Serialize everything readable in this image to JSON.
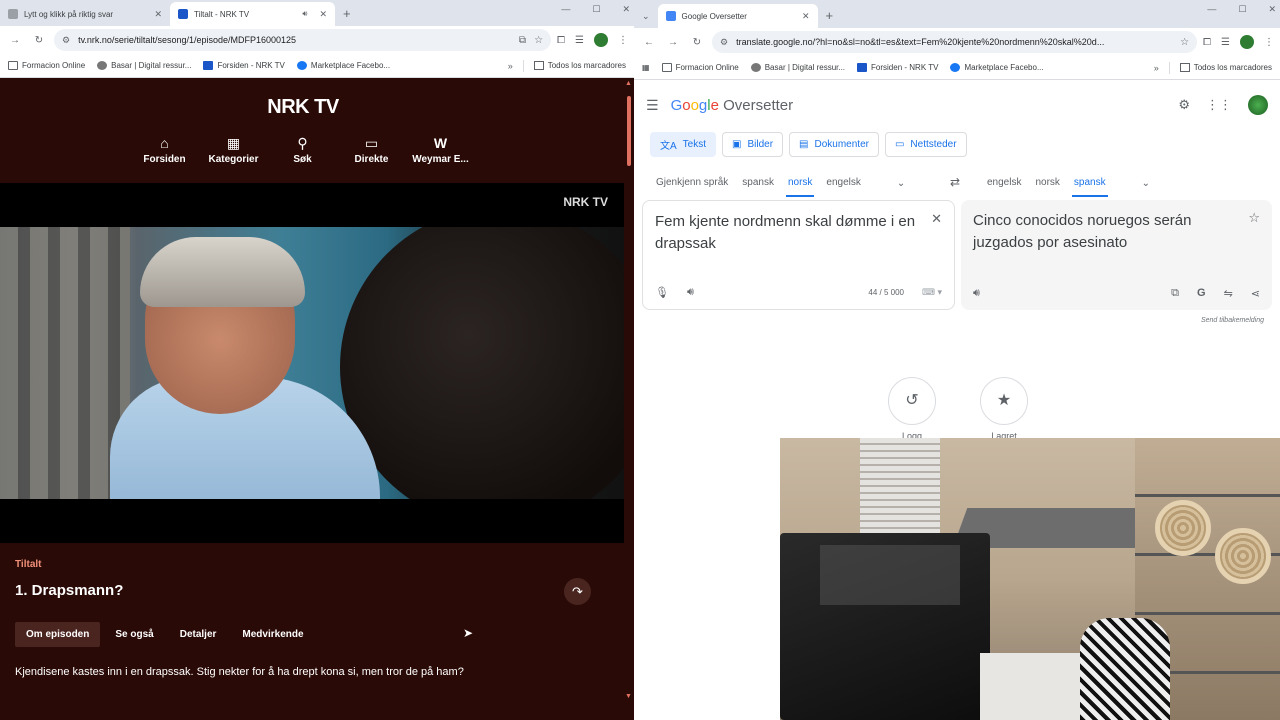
{
  "left_browser": {
    "tabs": [
      {
        "label": "Lytt og klikk på riktig svar",
        "active": false,
        "favicon_color": "#9aa0a6"
      },
      {
        "label": "Tiltalt - NRK TV",
        "active": true,
        "favicon_color": "#1a56c8"
      }
    ],
    "url": "tv.nrk.no/serie/tiltalt/sesong/1/episode/MDFP16000125",
    "bookmarks": [
      {
        "label": "Formacion Online",
        "icon": "folder-icon"
      },
      {
        "label": "Basar | Digital ressur...",
        "icon": "basar-icon"
      },
      {
        "label": "Forsiden - NRK TV",
        "icon": "nrk-icon"
      },
      {
        "label": "Marketplace Facebo...",
        "icon": "facebook-icon"
      }
    ],
    "bookmarks_more": "»",
    "all_bookmarks": "Todos los marcadores"
  },
  "nrk": {
    "logo": "NRK TV",
    "nav": [
      {
        "label": "Forsiden",
        "icon": "home-icon",
        "glyph": "⌂"
      },
      {
        "label": "Kategorier",
        "icon": "grid-icon",
        "glyph": "▦"
      },
      {
        "label": "Søk",
        "icon": "search-icon",
        "glyph": "⚲"
      },
      {
        "label": "Direkte",
        "icon": "tv-icon",
        "glyph": "▭"
      },
      {
        "label": "Weymar E...",
        "icon": "profile-initial-icon",
        "glyph": "W"
      }
    ],
    "player_watermark": "NRK TV",
    "series": "Tiltalt",
    "episode_title": "1. Drapsmann?",
    "tabs": [
      "Om episoden",
      "Se også",
      "Detaljer",
      "Medvirkende"
    ],
    "active_tab": 0,
    "description": "Kjendisene kastes inn i en drapssak. Stig nekter for å ha drept kona si, men tror de på ham?"
  },
  "right_browser": {
    "tabs": [
      {
        "label": "Google Oversetter",
        "active": true,
        "favicon_color": "#4285f4"
      }
    ],
    "url": "translate.google.no/?hl=no&sl=no&tl=es&text=Fem%20kjente%20nordmenn%20skal%20d...",
    "bookmarks": [
      {
        "label": "Formacion Online",
        "icon": "folder-icon"
      },
      {
        "label": "Basar | Digital ressur...",
        "icon": "basar-icon"
      },
      {
        "label": "Forsiden - NRK TV",
        "icon": "nrk-icon"
      },
      {
        "label": "Marketplace Facebo...",
        "icon": "facebook-icon"
      }
    ],
    "bookmarks_more": "»",
    "all_bookmarks": "Todos los marcadores"
  },
  "translate": {
    "app_title": "Google Oversetter",
    "modes": [
      {
        "label": "Tekst",
        "icon": "translate-icon",
        "glyph": "文A",
        "active": true
      },
      {
        "label": "Bilder",
        "icon": "image-icon",
        "glyph": "▣",
        "active": false
      },
      {
        "label": "Dokumenter",
        "icon": "document-icon",
        "glyph": "▤",
        "active": false
      },
      {
        "label": "Nettsteder",
        "icon": "website-icon",
        "glyph": "▭",
        "active": false
      }
    ],
    "source_langs": [
      "Gjenkjenn språk",
      "spansk",
      "norsk",
      "engelsk"
    ],
    "source_selected": 2,
    "target_langs": [
      "engelsk",
      "norsk",
      "spansk"
    ],
    "target_selected": 2,
    "source_text": "Fem kjente nordmenn skal dømme i en drapssak",
    "target_text": "Cinco conocidos noruegos serán juzgados por asesinato",
    "char_count": "44 / 5 000",
    "feedback": "Send tilbakemelding",
    "history": [
      {
        "label": "Logg",
        "icon": "history-icon",
        "glyph": "↺"
      },
      {
        "label": "Lagret",
        "icon": "star-icon",
        "glyph": "★"
      }
    ]
  },
  "colors": {
    "nrk_bg": "#2a0a06",
    "nrk_accent": "#f1907a",
    "google_blue": "#1a73e8"
  }
}
